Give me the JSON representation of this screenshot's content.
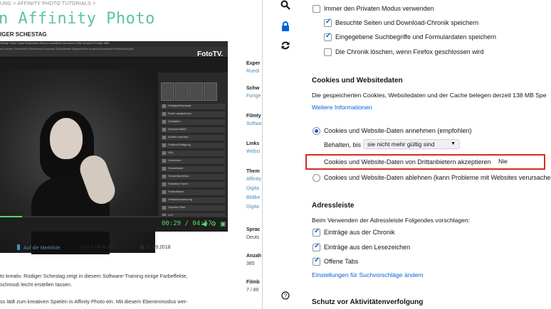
{
  "left_page": {
    "breadcrumb": "UNG  >  AFFINITY PHOTO TUTORIALS  >",
    "title": "n Affinity Photo",
    "author": "IGER SCHESTAG",
    "video": {
      "menubar": "Affinity Photo  Datei  Bearbeiten  Ebene  Auswählen  Anordnen  Filter  Ansicht  Fenster  Hilfe",
      "toolbar": "Ias kanten          Geometrie          Schrittweise          Auswahl          Quickdetaile          Magnetische Auswahl          Auswahlen Einblendungen",
      "brand": "FotoTV.",
      "time": "00:29 / 04:57",
      "progress_fraction": 0.098,
      "panel_rows": [
        "Helligkeit/Kontrast",
        "Farbe ausgleichen",
        "Gradation",
        "Schwarz/Weiß",
        "Kanäle mischen",
        "Farbton/Sättigung",
        "HSL",
        "Umkehren",
        "Schwellwert",
        "Tonwertkorrektur",
        "Selektive Farbe",
        "Farbbalance",
        "Verlaufsumsetzung",
        "Objektiv-Filter",
        "LUT"
      ]
    },
    "merkliste": "Auf die Merkliste",
    "duration": "0 h 04 m 57 s",
    "date": "17.09.2018",
    "desc_lines": [
      "to kreativ. Rüdiger Schestag zeigt in diesem Software-Training einige Farbeffekte,",
      "schmodi leicht erstellen lassen.",
      "",
      "ss lädt zum kreativen Spielen in Affinity Photo ein. Mit diesem Ebenenmodus wer-"
    ],
    "sidebar": [
      {
        "head": "Exper",
        "val": "Ruedi",
        "link": true
      },
      {
        "head": "Schw",
        "val": "Fortge",
        "link": true
      },
      {
        "head": "Filmty",
        "val": "Softwa",
        "link": true
      },
      {
        "head": "Links",
        "val": "Websi",
        "link": true
      },
      {
        "head": "Them",
        "vals": [
          "Affinity",
          "Digita",
          "Bildbe",
          "Digita"
        ],
        "link": true
      },
      {
        "head": "Sprac",
        "val": "Deuts",
        "link": false
      },
      {
        "head": "Anzah",
        "val": "385",
        "link": false
      },
      {
        "head": "Filmb",
        "val": "7 / 80",
        "link": false
      }
    ]
  },
  "prefs": {
    "side_icons": [
      "search-icon",
      "lock-icon",
      "sync-icon",
      "help-icon"
    ],
    "history": {
      "private_mode": {
        "label": "Immer den Privaten Modus verwenden",
        "checked": false
      },
      "visited_downloads": {
        "label": "Besuchte Seiten und Download-Chronik speichern",
        "checked": true
      },
      "search_form": {
        "label": "Eingegebene Suchbegriffe und Formulardaten speichern",
        "checked": true
      },
      "clear_on_close": {
        "label": "Die Chronik löschen, wenn Firefox geschlossen wird",
        "checked": false
      }
    },
    "cookies": {
      "heading": "Cookies und Websitedaten",
      "description": "Die gespeicherten Cookies, Websitedaten und der Cache belegen derzeit 138 MB Spe",
      "more_info": "Weitere Informationen",
      "accept_label": "Cookies und Website-Daten annehmen (empfohlen)",
      "keep_until_label": "Behalten, bis",
      "keep_until_value": "sie nicht mehr gültig sind",
      "third_party_label": "Cookies und Website-Daten von Drittanbietern akzeptieren",
      "third_party_value": "Nie",
      "reject_label": "Cookies und Website-Daten ablehnen (kann Probleme mit Websites verursachen)"
    },
    "address_bar": {
      "heading": "Adressleiste",
      "description": "Beim Verwenden der Adressleiste Folgendes vorschlagen:",
      "history": {
        "label": "Einträge aus der Chronik",
        "checked": true
      },
      "bookmarks": {
        "label": "Einträge aus den Lesezeichen",
        "checked": true
      },
      "open_tabs": {
        "label": "Offene Tabs",
        "checked": true
      },
      "settings_link": "Einstellungen für Suchvorschläge ändern"
    },
    "tracking": {
      "heading": "Schutz vor Aktivitätenverfolgung"
    }
  }
}
